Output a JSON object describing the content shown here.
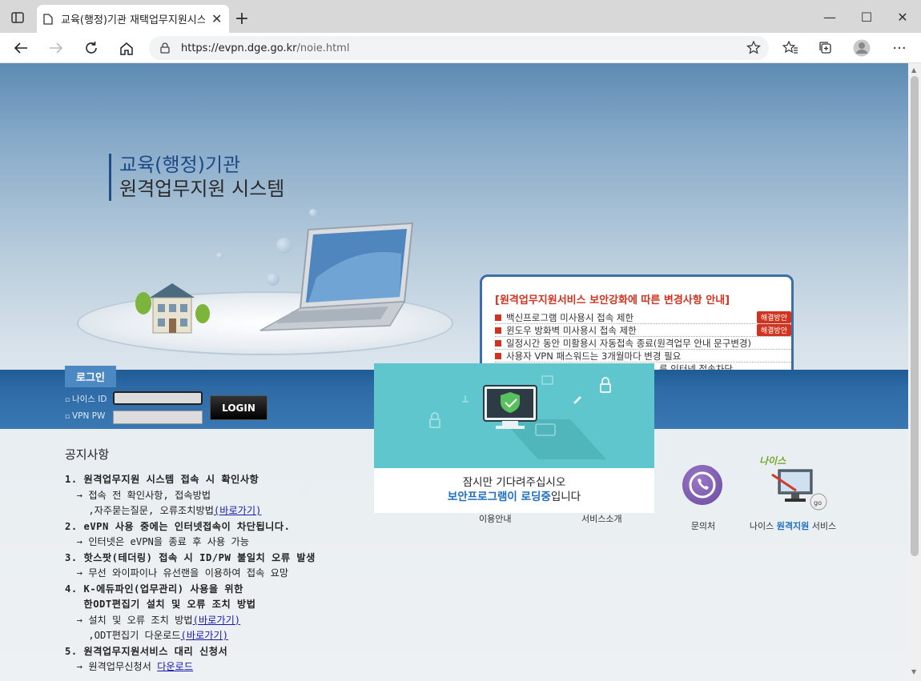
{
  "browser": {
    "tab_title": "교육(행정)기관 재택업무지원시스템",
    "url_domain": "https://evpn.dge.go.kr",
    "url_path": "/noie.html"
  },
  "site": {
    "title_line1": "교육(행정)기관",
    "title_line2": "원격업무지원 시스템"
  },
  "notice_box": {
    "title": "[원격업무지원서비스 보안강화에 따른 변경사항 안내]",
    "items": [
      {
        "text": "백신프로그램 미사용시 접속 제한",
        "badge": "해결방안"
      },
      {
        "text": "윈도우 방화벽 미사용시 접속 제한",
        "badge": "해결방안"
      },
      {
        "text": "일정시간 동안 미활용시 자동접속 종료(원격업무 안내 문구변경)",
        "badge": ""
      },
      {
        "text": "사용자 VPN 패스워드는 3개월마다 변경 필요",
        "badge": ""
      },
      {
        "text": "른 인터넷 접속차단",
        "badge": ""
      }
    ]
  },
  "login": {
    "tab_label": "로그인",
    "id_label": "나이스 ID",
    "pw_label": "VPN PW",
    "button_label": "LOGIN"
  },
  "notice": {
    "title": "공지사항",
    "lines": [
      {
        "text": "1. 원격업무지원 시스템 접속 시 확인사항",
        "link": "",
        "head": true
      },
      {
        "text": "  → 접속 전 확인사항, 접속방법",
        "link": "",
        "head": false
      },
      {
        "text": "    ,자주묻는질문, 오류조치방법",
        "link": "(바로가기)",
        "head": false
      },
      {
        "text": "2. eVPN 사용 중에는 인터넷접속이 차단됩니다.",
        "link": "",
        "head": true
      },
      {
        "text": "  → 인터넷은 eVPN을 종료 후 사용 가능",
        "link": "",
        "head": false
      },
      {
        "text": "3. 핫스팟(테더링) 접속 시 ID/PW 불일치 오류 발생",
        "link": "",
        "head": true
      },
      {
        "text": "  → 무선 와이파이나 유선랜을 이용하여 접속 요망",
        "link": "",
        "head": false
      },
      {
        "text": "4. K-에듀파인(업무관리) 사용을 위한",
        "link": "",
        "head": true
      },
      {
        "text": "   한ODT편집기 설치 및 오류 조치 방법",
        "link": "",
        "head": true
      },
      {
        "text": "  → 설치 및 오류 조치 방법",
        "link": "(바로가기)",
        "head": false
      },
      {
        "text": "    ,ODT편집기 다운로드",
        "link": "(바로가기)",
        "head": false
      },
      {
        "text": "5. 원격업무지원서비스 대리 신청서",
        "link": "",
        "head": true
      },
      {
        "text": "  → 원격업무신청서 ",
        "link": "다운로드",
        "head": false
      }
    ]
  },
  "services": {
    "usage_label": "이용안내",
    "intro_label": "서비스소개",
    "consult_label": "문의처",
    "neis_label_pre": "나이스 ",
    "neis_label_hl": "원격지원",
    "neis_label_post": " 서비스",
    "neis_logo": "나이스"
  },
  "overlay": {
    "message1": "잠시만 기다려주십시오",
    "message2_highlight": "보안프로그램이 로딩중",
    "message2_rest": "입니다"
  },
  "colors": {
    "overlay_teal": "#5ec6cc",
    "notice_red": "#d0331f",
    "highlight_blue": "#1f6fc0",
    "login_bar": "#2d6aa6"
  }
}
